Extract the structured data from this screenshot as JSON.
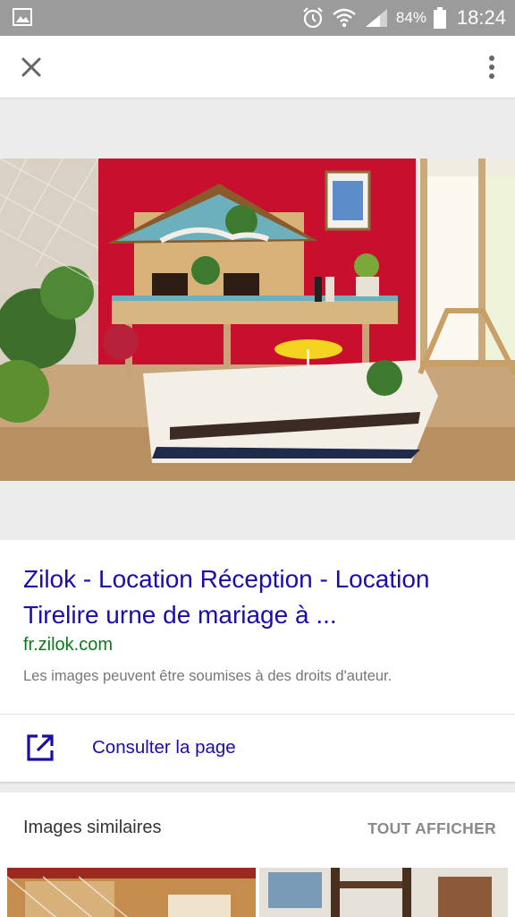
{
  "status_bar": {
    "battery": "84%",
    "time": "18:24",
    "icons": [
      "gallery-icon",
      "alarm-icon",
      "wifi-icon",
      "signal-icon",
      "battery-icon"
    ]
  },
  "toolbar": {
    "close_icon": "close-icon",
    "menu_icon": "more-vert-icon"
  },
  "result": {
    "title": "Zilok - Location Réception - Location Tirelire urne de mariage à ...",
    "url": "fr.zilok.com",
    "copyright": "Les images peuvent être soumises à des droits d'auteur.",
    "visit_label": "Consulter la page",
    "visit_icon": "open-in-new-icon"
  },
  "similar": {
    "title": "Images similaires",
    "show_all": "TOUT AFFICHER"
  },
  "colors": {
    "link": "#1a0dab",
    "url": "#0b7a1d",
    "status_bar": "#9b9b9b",
    "background": "#ececec"
  }
}
